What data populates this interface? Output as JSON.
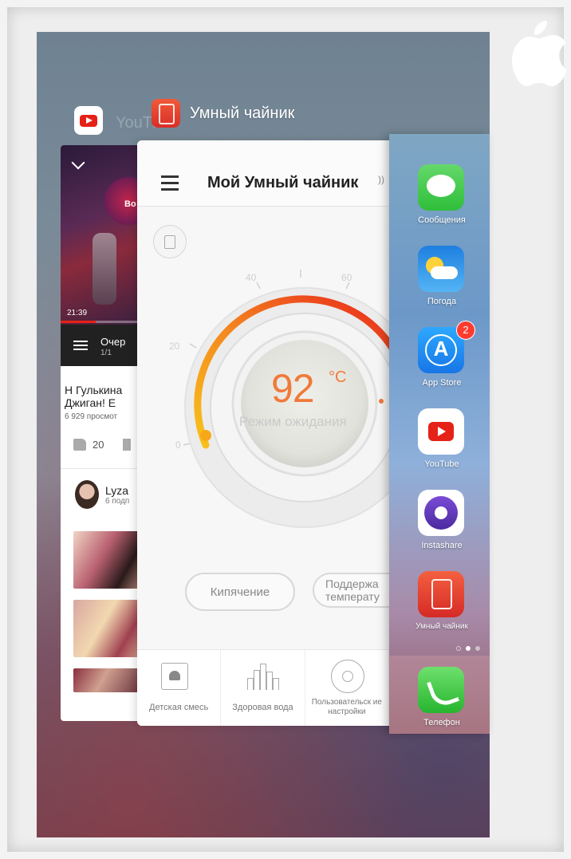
{
  "youtube": {
    "app_name": "YouTube",
    "video_time": "21:39",
    "video_overlay_text": "Bo",
    "queue_title": "Очер",
    "queue_count": "1/1",
    "video_title_line1": "Н Гулькина",
    "video_title_line2": "Джиган!  Е",
    "views": "6 929 просмот",
    "likes": "20",
    "channel_name": "Lyza",
    "channel_subs": "6 подп"
  },
  "kettle": {
    "app_name": "Умный чайник",
    "title": "Мой Умный чайник",
    "temperature": "92",
    "unit": "°C",
    "mode": "Режим ожидания",
    "dial_ticks": [
      "0",
      "20",
      "40",
      "60"
    ],
    "boil_button": "Кипячение",
    "keep_button_line1": "Поддержа",
    "keep_button_line2": "температу",
    "tabs": [
      "Детская смесь",
      "Здоровая вода",
      "Пользовательск ие настройки"
    ],
    "accent": "#f07a3a"
  },
  "home": {
    "apps": [
      {
        "label": "Сообщения",
        "icon": "messages-icon"
      },
      {
        "label": "Погода",
        "icon": "weather-icon"
      },
      {
        "label": "App Store",
        "icon": "app-store-icon",
        "badge": "2"
      },
      {
        "label": "YouTube",
        "icon": "youtube-icon"
      },
      {
        "label": "Instashare",
        "icon": "instashare-icon"
      },
      {
        "label": "Умный чайник",
        "icon": "kettle-icon"
      }
    ],
    "dock": {
      "label": "Телефон",
      "icon": "phone-icon"
    }
  }
}
